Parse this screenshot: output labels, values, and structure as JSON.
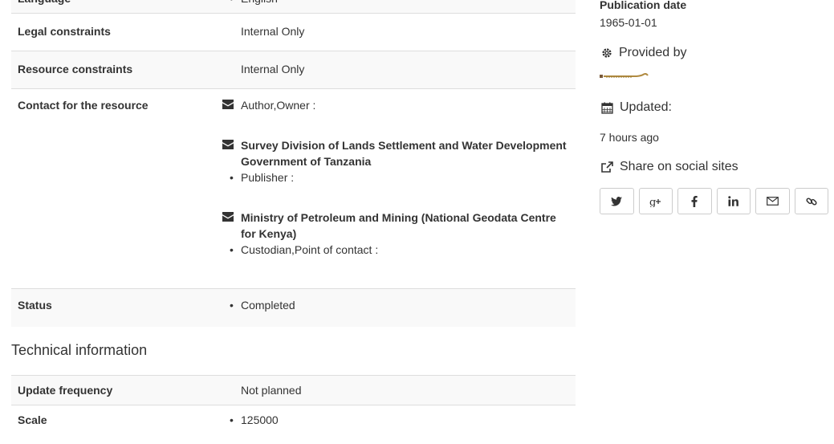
{
  "colors": {
    "text": "#333333",
    "row_alt": "#f9f9f9",
    "border": "#dddddd"
  },
  "rows_top": {
    "language": {
      "label": "Language",
      "value": "English"
    },
    "legal": {
      "label": "Legal constraints",
      "value": "Internal Only"
    },
    "resource": {
      "label": "Resource constraints",
      "value": "Internal Only"
    },
    "contact": {
      "label": "Contact for the resource",
      "entries": [
        {
          "org": "",
          "role": "Author,Owner :"
        },
        {
          "org": "Survey Division of Lands Settlement and Water Development Government of Tanzania",
          "role": "Publisher :"
        },
        {
          "org": "Ministry of Petroleum and Mining (National Geodata Centre for Kenya)",
          "role": "Custodian,Point of contact :"
        }
      ]
    },
    "status": {
      "label": "Status",
      "value": "Completed"
    }
  },
  "technical": {
    "heading": "Technical information",
    "update_frequency": {
      "label": "Update frequency",
      "value": "Not planned"
    },
    "scale": {
      "label": "Scale",
      "value": "125000"
    }
  },
  "sidebar": {
    "publication_label": "Publication date",
    "publication_value": "1965-01-01",
    "provided_by": "Provided by",
    "updated_label": "Updated:",
    "updated_value": "7 hours ago",
    "share_label": "Share on social sites",
    "share_icons": [
      "twitter-icon",
      "google-plus-icon",
      "facebook-icon",
      "linkedin-icon",
      "email-icon",
      "link-icon"
    ]
  }
}
